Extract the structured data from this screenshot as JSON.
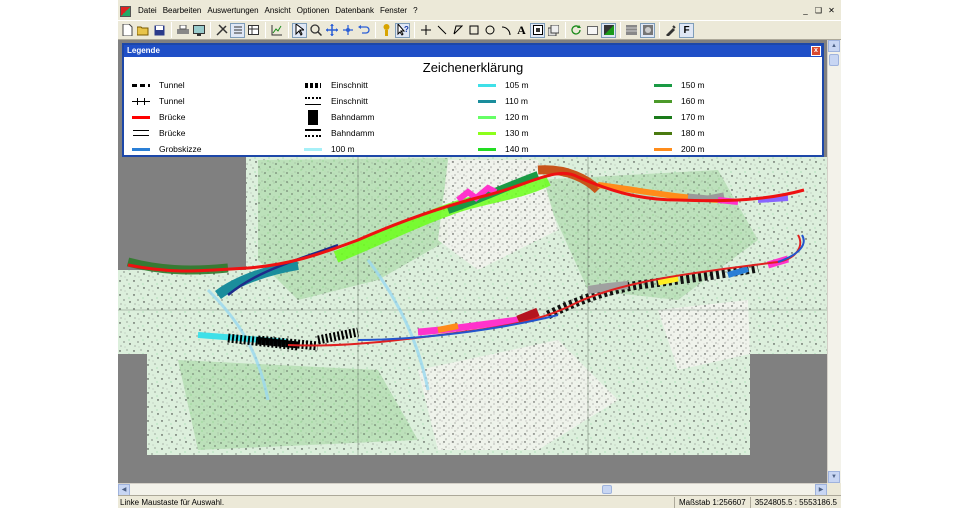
{
  "menu": [
    "Datei",
    "Bearbeiten",
    "Auswertungen",
    "Ansicht",
    "Optionen",
    "Datenbank",
    "Fenster",
    "?"
  ],
  "window_controls": [
    "_",
    "❑",
    "✕"
  ],
  "toolbar": {
    "label_letter": "A",
    "label_f": "F"
  },
  "legend": {
    "title": "Legende",
    "close": "x",
    "heading": "Zeichenerklärung",
    "col1": [
      {
        "label": "Tunnel",
        "symbol": "dash"
      },
      {
        "label": "Tunnel",
        "symbol": "tick"
      },
      {
        "label": "Brücke",
        "symbol": "line",
        "color": "#ff0000"
      },
      {
        "label": "Brücke",
        "symbol": "bridge2"
      },
      {
        "label": "Grobskizze",
        "symbol": "line",
        "color": "#2a7fd6"
      }
    ],
    "col2": [
      {
        "label": "Einschnitt",
        "symbol": "cut"
      },
      {
        "label": "Einschnitt",
        "symbol": "cut2"
      },
      {
        "label": "Bahndamm",
        "symbol": "dam"
      },
      {
        "label": "Bahndamm",
        "symbol": "dam2"
      },
      {
        "label": "100 m",
        "symbol": "line",
        "color": "#a6f0f8"
      }
    ],
    "col3": [
      {
        "label": "105 m",
        "color": "#3fe0e8"
      },
      {
        "label": "110 m",
        "color": "#1a8d9c"
      },
      {
        "label": "120 m",
        "color": "#66ff66"
      },
      {
        "label": "130 m",
        "color": "#8cff1a"
      },
      {
        "label": "140 m",
        "color": "#22dd22"
      }
    ],
    "col4": [
      {
        "label": "150 m",
        "color": "#1a9a44"
      },
      {
        "label": "160 m",
        "color": "#4c9a2a"
      },
      {
        "label": "170 m",
        "color": "#1a7a1a"
      },
      {
        "label": "180 m",
        "color": "#4a7a10"
      },
      {
        "label": "200 m",
        "color": "#ff8c1a"
      }
    ]
  },
  "status": {
    "hint": "Linke Maustaste für Auswahl.",
    "scale": "Maßstab 1:256607",
    "coords": "3524805.5 : 5553186.5"
  }
}
